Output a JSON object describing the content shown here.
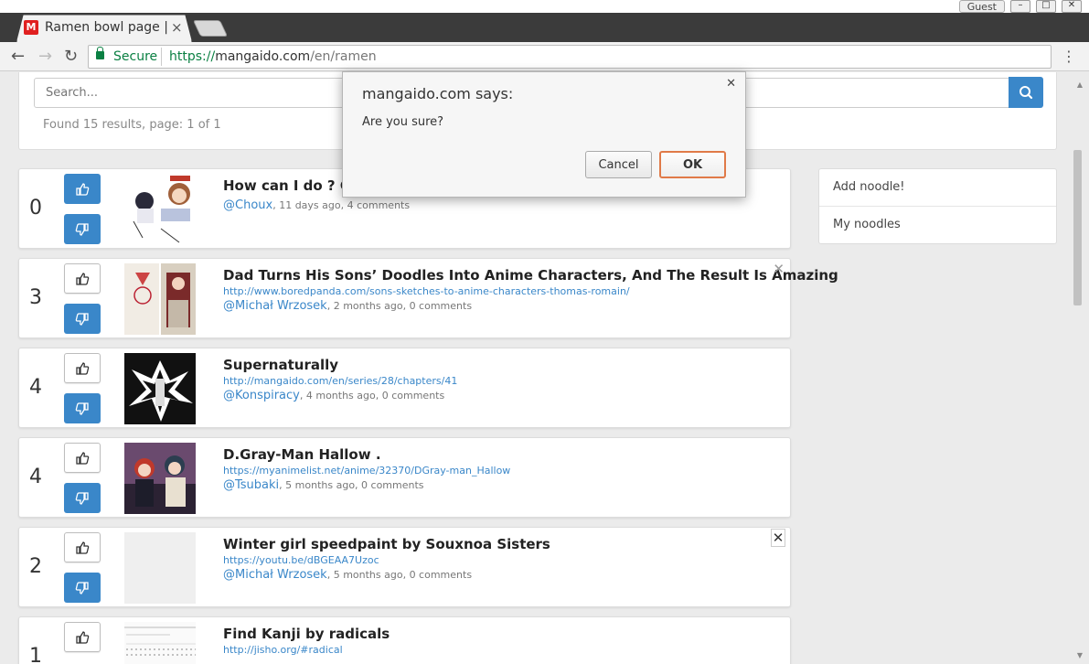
{
  "browser": {
    "tab_title": "Ramen bowl page |",
    "tab_favicon_letter": "M",
    "guest_label": "Guest",
    "secure_label": "Secure",
    "url_scheme": "https://",
    "url_host": "mangaido.com",
    "url_path": "/en/ramen"
  },
  "search": {
    "placeholder": "Search...",
    "results_info": "Found 15 results, page: 1 of 1"
  },
  "dialog": {
    "title": "mangaido.com says:",
    "message": "Are you sure?",
    "cancel_label": "Cancel",
    "ok_label": "OK"
  },
  "side_menu": {
    "items": [
      {
        "label": "Add noodle!"
      },
      {
        "label": "My noodles"
      }
    ]
  },
  "posts": [
    {
      "score": "0",
      "title": "How can I do ? Co",
      "link": "",
      "author": "@Choux",
      "meta": ", 11 days ago, 4 comments",
      "voted": "blue"
    },
    {
      "score": "3",
      "title": "Dad Turns His Sons’ Doodles Into Anime Characters, And The Result Is Amazing",
      "link": "http://www.boredpanda.com/sons-sketches-to-anime-characters-thomas-romain/",
      "author": "@Michał Wrzosek",
      "meta": ", 2 months ago, 0 comments",
      "voted": "down"
    },
    {
      "score": "4",
      "title": "Supernaturally",
      "link": "http://mangaido.com/en/series/28/chapters/41",
      "author": "@Konspiracy",
      "meta": ", 4 months ago, 0 comments",
      "voted": "down"
    },
    {
      "score": "4",
      "title": "D.Gray-Man Hallow .",
      "link": "https://myanimelist.net/anime/32370/DGray-man_Hallow",
      "author": "@Tsubaki",
      "meta": ", 5 months ago, 0 comments",
      "voted": "down"
    },
    {
      "score": "2",
      "title": "Winter girl speedpaint by Souxnoa Sisters",
      "link": "https://youtu.be/dBGEAA7Uzoc",
      "author": "@Michał Wrzosek",
      "meta": ", 5 months ago, 0 comments",
      "voted": "down"
    },
    {
      "score": "1",
      "title": "Find Kanji by radicals",
      "link": "http://jisho.org/#radical",
      "author": "",
      "meta": "",
      "voted": "down"
    }
  ],
  "colors": {
    "primary": "#3a87c9",
    "secure_green": "#0b8043",
    "ok_outline": "#e07a48"
  }
}
